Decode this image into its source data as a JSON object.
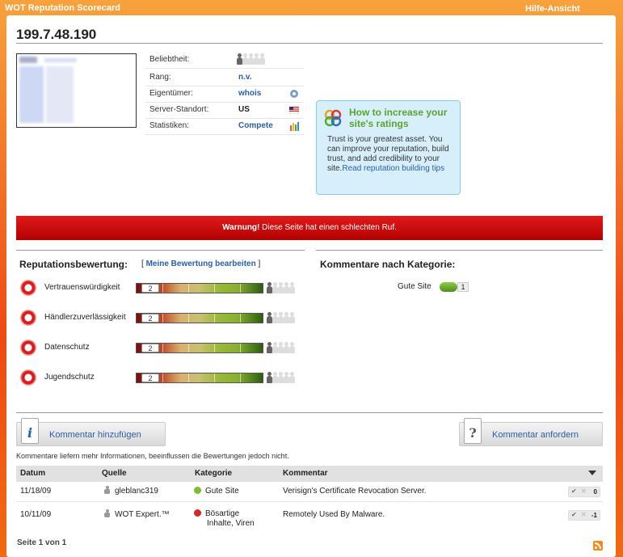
{
  "app": {
    "title": "WOT Reputation Scorecard",
    "help_view": "Hilfe-Ansicht"
  },
  "site": {
    "ip": "199.7.48.190"
  },
  "info": {
    "popularity_label": "Beliebtheit:",
    "rank_label": "Rang:",
    "rank_value": "n.v.",
    "owner_label": "Eigentümer:",
    "owner_value": "whois",
    "server_label": "Server-Standort:",
    "server_value": "US",
    "stats_label": "Statistiken:",
    "stats_value": "Compete"
  },
  "tip": {
    "title": "How to increase your site's ratings",
    "body": "Trust is your greatest asset. You can improve your reputation, build trust, and add credibility to your site.",
    "link": "Read reputation building tips"
  },
  "warning": {
    "strong": "Warnung!",
    "text": " Diese Seite hat einen schlechten Ruf."
  },
  "reputation": {
    "title": "Reputationsbewertung:",
    "edit_open": "[ ",
    "edit_link": "Meine Bewertung bearbeiten",
    "edit_close": " ]",
    "rows": [
      {
        "name": "Vertrauenswürdigkeit",
        "count": "2"
      },
      {
        "name": "Händlerzuverlässigkeit",
        "count": "2"
      },
      {
        "name": "Datenschutz",
        "count": "2"
      },
      {
        "name": "Jugendschutz",
        "count": "2"
      }
    ]
  },
  "categories": {
    "title": "Kommentare nach Kategorie:",
    "items": [
      {
        "label": "Gute Site",
        "count": "1",
        "color": "#6aa832"
      }
    ]
  },
  "buttons": {
    "add_comment": "Kommentar hinzufügen",
    "request_comment": "Kommentar anfordern"
  },
  "note": "Kommentare liefern mehr Informationen, beeinflussen die Bewertungen jedoch nicht.",
  "table": {
    "headers": {
      "date": "Datum",
      "source": "Quelle",
      "category": "Kategorie",
      "comment": "Kommentar"
    },
    "rows": [
      {
        "date": "11/18/09",
        "source": "gleblanc319",
        "category": "Gute Site",
        "category_color": "#7cbf2e",
        "comment": "Verisign's Certificate Revocation Server.",
        "votes": "0"
      },
      {
        "date": "10/11/09",
        "source": "WOT Expert.™",
        "category_line1": "Bösartige",
        "category_line2": "Inhalte, Viren",
        "category_color": "#d62828",
        "comment": "Remotely Used By Malware.",
        "votes": "-1"
      }
    ]
  },
  "pager": "Seite 1 von 1",
  "icons": {
    "owner": "whois-gear-icon",
    "server": "us-flag-icon",
    "stats": "bar-chart-icon",
    "tip": "rings-icon",
    "info": "info-icon",
    "question": "question-icon",
    "feed": "rss-icon"
  },
  "colors": {
    "accent_orange": "#ee4a14",
    "warning_red": "#d20f0f",
    "link_blue": "#2a5fa8",
    "tip_green": "#5aa42b"
  }
}
